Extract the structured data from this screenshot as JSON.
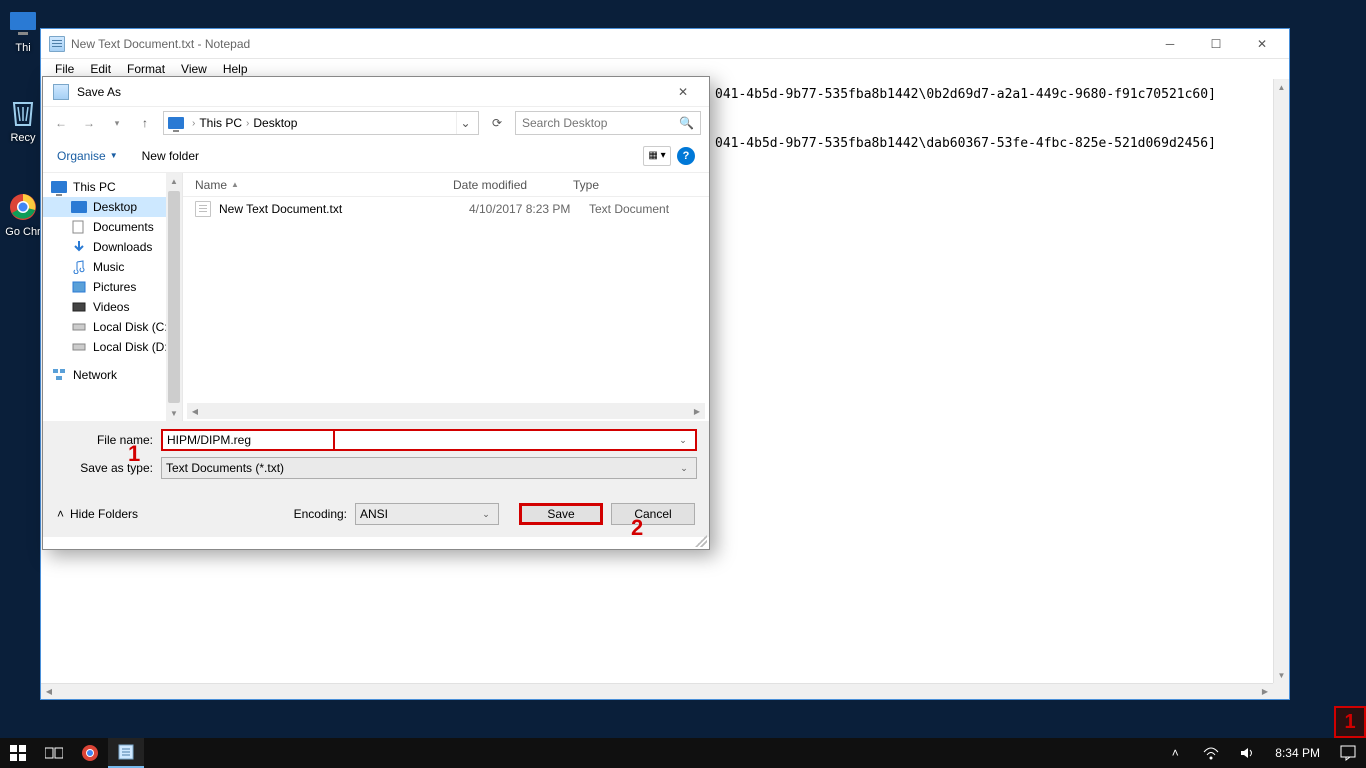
{
  "desktop": {
    "icons": [
      {
        "label": "Thi"
      },
      {
        "label": "Recy"
      },
      {
        "label": "Go\nChr"
      }
    ]
  },
  "notepad": {
    "title": "New Text Document.txt - Notepad",
    "menu": {
      "file": "File",
      "edit": "Edit",
      "format": "Format",
      "view": "View",
      "help": "Help"
    },
    "content_line1": "041-4b5d-9b77-535fba8b1442\\0b2d69d7-a2a1-449c-9680-f91c70521c60]",
    "content_line2": "041-4b5d-9b77-535fba8b1442\\dab60367-53fe-4fbc-825e-521d069d2456]"
  },
  "saveas": {
    "title": "Save As",
    "breadcrumb": {
      "root": "This PC",
      "chev": "›",
      "current": "Desktop"
    },
    "search_placeholder": "Search Desktop",
    "toolbar": {
      "organise": "Organise",
      "newfolder": "New folder"
    },
    "tree": {
      "thispc": "This PC",
      "desktop": "Desktop",
      "documents": "Documents",
      "downloads": "Downloads",
      "music": "Music",
      "pictures": "Pictures",
      "videos": "Videos",
      "localc": "Local Disk (C:)",
      "locald": "Local Disk (D:)",
      "network": "Network"
    },
    "columns": {
      "name": "Name",
      "date": "Date modified",
      "type": "Type"
    },
    "rows": [
      {
        "name": "New Text Document.txt",
        "date": "4/10/2017 8:23 PM",
        "type": "Text Document"
      }
    ],
    "filename_label": "File name:",
    "filename_value": "HIPM/DIPM.reg",
    "savetype_label": "Save as type:",
    "savetype_value": "Text Documents (*.txt)",
    "encoding_label": "Encoding:",
    "encoding_value": "ANSI",
    "hide_folders": "Hide Folders",
    "save_btn": "Save",
    "cancel_btn": "Cancel"
  },
  "annotations": {
    "one": "1",
    "two": "2",
    "badge": "1"
  },
  "taskbar": {
    "clock": "8:34 PM"
  }
}
